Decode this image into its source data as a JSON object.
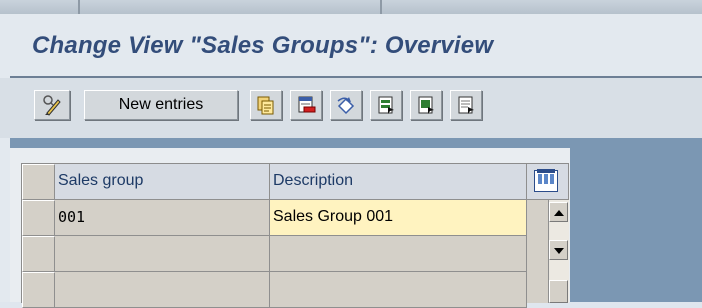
{
  "header": {
    "title": "Change View \"Sales Groups\": Overview"
  },
  "toolbar": {
    "buttons": [
      {
        "icon": "display-change-icon"
      },
      {
        "label": "New entries"
      },
      {
        "icon": "copy-as-icon"
      },
      {
        "icon": "delete-icon"
      },
      {
        "icon": "undo-change-icon"
      },
      {
        "icon": "select-all-icon"
      },
      {
        "icon": "select-block-icon"
      },
      {
        "icon": "deselect-all-icon"
      }
    ]
  },
  "table": {
    "columns": [
      "Sales group",
      "Description"
    ],
    "rows": [
      {
        "sales_group": "001",
        "description": "Sales Group 001"
      },
      {
        "sales_group": "",
        "description": ""
      },
      {
        "sales_group": "",
        "description": ""
      }
    ]
  },
  "colors": {
    "title": "#334d7a",
    "work_area": "#7b97b3",
    "selected_cell": "#fff3c0"
  }
}
